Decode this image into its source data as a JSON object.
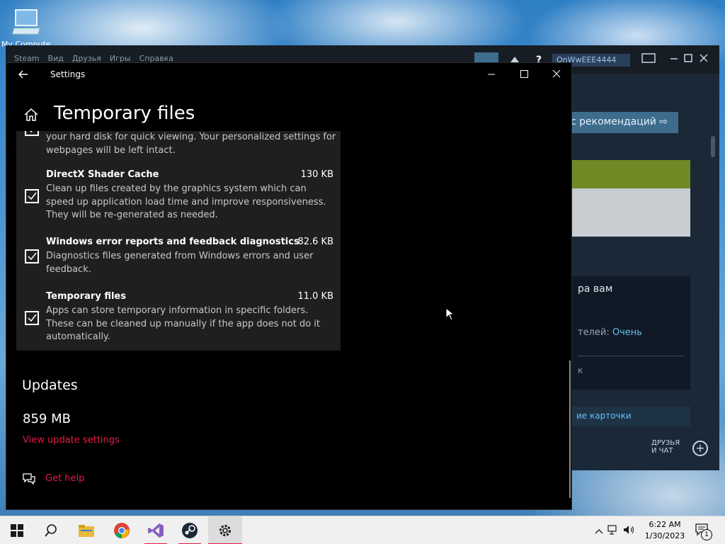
{
  "desktop": {
    "icon_label": "My Computer"
  },
  "steam": {
    "menu": [
      "Steam",
      "Вид",
      "Друзья",
      "Игры",
      "Справка"
    ],
    "username": "OnWwEEE4444",
    "recommend_label": "с рекомендаций",
    "card_title": "ра вам",
    "card_text_prefix": "телей:",
    "card_text_value": "Очень",
    "card_k": "к",
    "cards_link": "ие карточки",
    "friends_label_1": "ДРУЗЬЯ",
    "friends_label_2": "И ЧАТ"
  },
  "window": {
    "title": "Settings",
    "page_title": "Temporary files"
  },
  "items": [
    {
      "name": "",
      "size": "",
      "description": "your hard disk for quick viewing. Your personalized settings for webpages will be left intact.",
      "checked": true
    },
    {
      "name": "DirectX Shader Cache",
      "size": "130 KB",
      "description": "Clean up files created by the graphics system which can speed up application load time and improve responsiveness. They will be re-generated as needed.",
      "checked": true
    },
    {
      "name": "Windows error reports and feedback diagnostics",
      "size": "82.6 KB",
      "description": "Diagnostics files generated from Windows errors and user feedback.",
      "checked": true
    },
    {
      "name": "Temporary files",
      "size": "11.0 KB",
      "description": "Apps can store temporary information in specific folders. These can be cleaned up manually if the app does not do it automatically.",
      "checked": true
    }
  ],
  "updates": {
    "heading": "Updates",
    "size": "859 MB",
    "link": "View update settings"
  },
  "help": {
    "label": "Get help"
  },
  "taskbar": {
    "apps": [
      "start-icon",
      "search-icon",
      "file-explorer-icon",
      "chrome-icon",
      "visual-studio-icon",
      "steam-icon",
      "settings-icon"
    ],
    "active_app": "settings-icon",
    "time": "6:22 AM",
    "date": "1/30/2023",
    "notification_count": "1"
  },
  "colors": {
    "accent": "#e8174a",
    "panel": "#1f1f1f",
    "window_bg": "#000000"
  }
}
